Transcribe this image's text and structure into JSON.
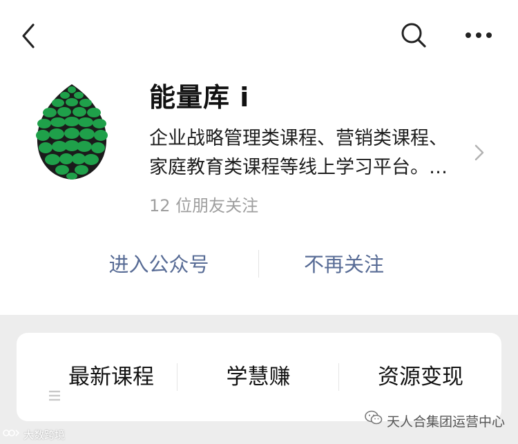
{
  "account": {
    "name": "能量库 i",
    "description_line1": "企业战略管理类课程、营销类课程、",
    "description_line2": "家庭教育类课程等线上学习平台。…",
    "followers": "12 位朋友关注"
  },
  "actions": {
    "enter": "进入公众号",
    "unfollow": "不再关注"
  },
  "menu": {
    "items": [
      {
        "label": "最新课程",
        "icon": "menu-lines-icon"
      },
      {
        "label": "学慧赚"
      },
      {
        "label": "资源变现"
      }
    ]
  },
  "watermarks": {
    "left": "大数跨境",
    "right": "天人合集团运营中心"
  },
  "icons": {
    "back": "back-arrow-icon",
    "search": "search-icon",
    "more": "more-dots-icon",
    "chevron": "chevron-right-icon",
    "avatar": "pinecone-icon"
  },
  "colors": {
    "link": "#576b95",
    "avatar_green": "#1fa04a",
    "avatar_dark": "#1b1b1b",
    "background_gray": "#ededed",
    "muted_text": "#9e9e9e"
  }
}
